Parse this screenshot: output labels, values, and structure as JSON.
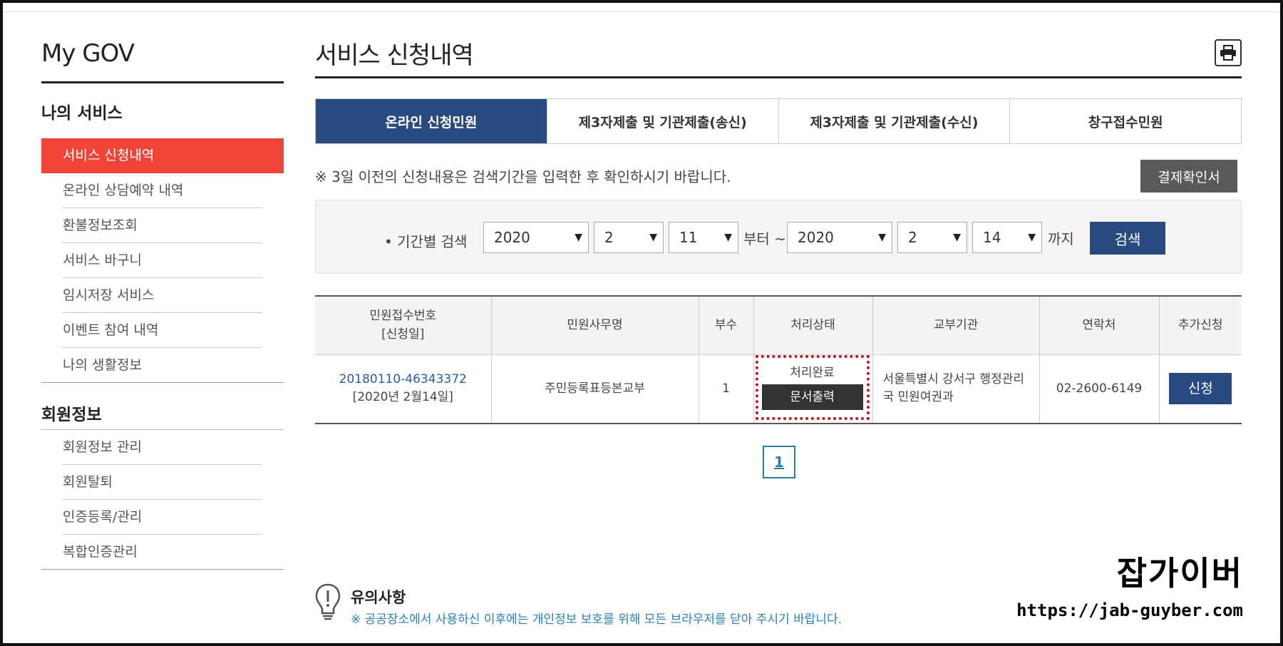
{
  "sidebar": {
    "brand": "My GOV",
    "section1_title": "나의 서비스",
    "items1": [
      {
        "label": "서비스 신청내역"
      },
      {
        "label": "온라인 상담예약 내역"
      },
      {
        "label": "환불정보조회"
      },
      {
        "label": "서비스 바구니"
      },
      {
        "label": "임시저장 서비스"
      },
      {
        "label": "이벤트 참여 내역"
      },
      {
        "label": "나의 생활정보"
      }
    ],
    "section2_title": "회원정보",
    "items2": [
      {
        "label": "회원정보 관리"
      },
      {
        "label": "회원탈퇴"
      },
      {
        "label": "인증등록/관리"
      },
      {
        "label": "복합인증관리"
      }
    ]
  },
  "main": {
    "title": "서비스 신청내역",
    "tabs": [
      {
        "label": "온라인 신청민원"
      },
      {
        "label": "제3자제출 및 기관제출(송신)"
      },
      {
        "label": "제3자제출 및 기관제출(수신)"
      },
      {
        "label": "창구접수민원"
      }
    ],
    "notice": "※ 3일 이전의 신청내용은 검색기간을 입력한 후 확인하시기 바랍니다.",
    "payment_button": "결제확인서",
    "search": {
      "label": "• 기간별 검색",
      "from_year": "2020",
      "from_month": "2",
      "from_day": "11",
      "from_suffix": "부터 ~",
      "to_year": "2020",
      "to_month": "2",
      "to_day": "14",
      "to_suffix": "까지",
      "button": "검색",
      "caret": "▼"
    },
    "table": {
      "headers": {
        "receipt_no": "민원접수번호",
        "receipt_date": "[신청일]",
        "name": "민원사무명",
        "copies": "부수",
        "status": "처리상태",
        "agency": "교부기관",
        "contact": "연락처",
        "extra": "추가신청"
      },
      "row": {
        "receipt_no": "20180110-46343372",
        "receipt_date": "[2020년 2월14일]",
        "name": "주민등록표등본교부",
        "copies": "1",
        "status": "처리완료",
        "doc_button": "문서출력",
        "agency": "서울특별시 강서구 행정관리국 민원여권과",
        "contact": "02-2600-6149",
        "apply_button": "신청"
      }
    },
    "page": "1"
  },
  "caution": {
    "title": "유의사항",
    "text": "※ 공공장소에서 사용하신 이후에는 개인정보 보호를 위해 모든 브라우저를 닫아 주시기 바랍니다."
  },
  "watermark": {
    "title": "잡가이버",
    "url": "https://jab-guyber.com"
  },
  "colors": {
    "active_menu": "#ef4437",
    "navy": "#284a7e",
    "highlight": "#c0111f"
  }
}
